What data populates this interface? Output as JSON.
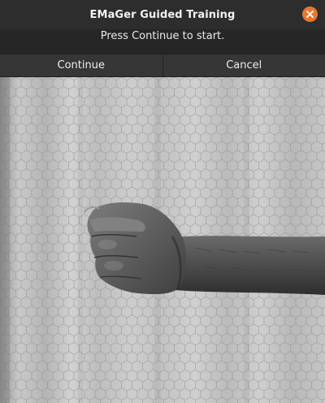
{
  "window": {
    "title": "EMaGer Guided Training",
    "close_icon": "close-icon",
    "accent_color": "#e9772f"
  },
  "prompt": {
    "message": "Press Continue to start."
  },
  "buttons": {
    "continue_label": "Continue",
    "cancel_label": "Cancel"
  },
  "gesture_image": {
    "icon": "hand-closed-fist-photo",
    "style": "grayscale"
  }
}
